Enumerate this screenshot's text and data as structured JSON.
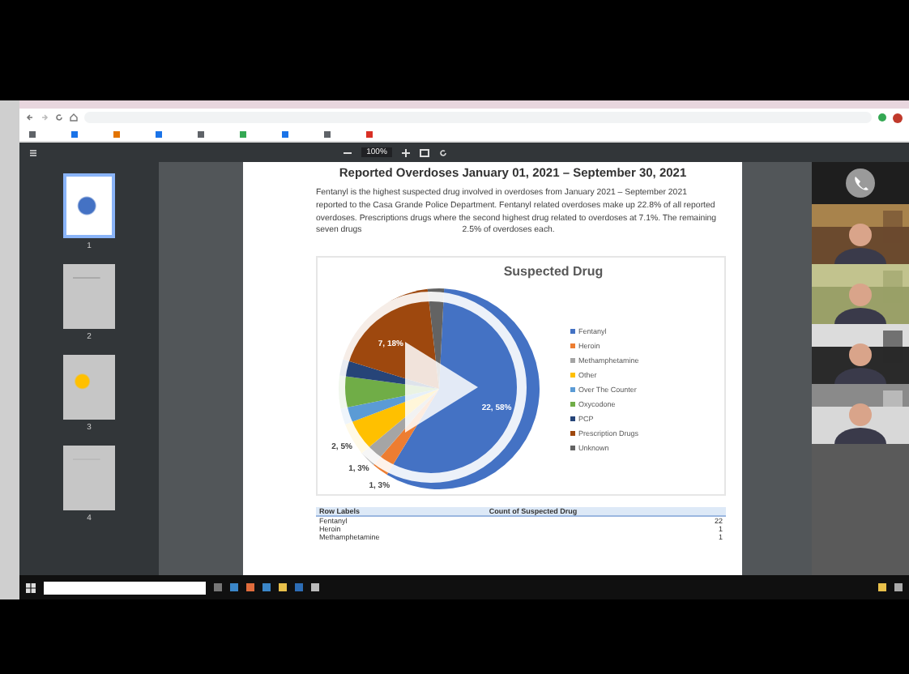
{
  "pdf_toolbar": {
    "zoom": "100%"
  },
  "thumbnails": [
    {
      "label": "1",
      "selected": true
    },
    {
      "label": "2",
      "selected": false
    },
    {
      "label": "3",
      "selected": false
    },
    {
      "label": "4",
      "selected": false
    }
  ],
  "document": {
    "heading": "Reported Overdoses January 01, 2021 – September 30, 2021",
    "paragraph": [
      "Fentanyl is the highest suspected drug involved in overdoses from January 2021 – September 2021 reported to the Casa Grande Police Department. Fentanyl related overdoses make up 22.8% of all reported overdoses. Prescriptions drugs where the second highest drug related to overdoses at 7.1%. The remaining seven drugs",
      "2.5% of overdoses each."
    ],
    "chart_data": {
      "type": "pie",
      "title": "Suspected Drug",
      "categories": [
        "Fentanyl",
        "Heroin",
        "Methamphetamine",
        "Other",
        "Over The Counter",
        "Oxycodone",
        "PCP",
        "Prescription Drugs",
        "Unknown"
      ],
      "values": [
        22,
        1,
        1,
        2,
        1,
        2,
        1,
        7,
        1
      ],
      "colors": [
        "#4472c4",
        "#ed7d31",
        "#a5a5a5",
        "#ffc000",
        "#5b9bd5",
        "#70ad47",
        "#264478",
        "#9e480e",
        "#636363"
      ],
      "value_labels": [
        "22, 58%",
        "1, 3%",
        "1, 3%",
        "2, 5%",
        null,
        null,
        null,
        "7, 18%",
        null
      ]
    },
    "table": {
      "columns": [
        "Row Labels",
        "Count of Suspected Drug"
      ],
      "rows": [
        [
          "Fentanyl",
          "22"
        ],
        [
          "Heroin",
          "1"
        ],
        [
          "Methamphetamine",
          "1"
        ]
      ]
    }
  },
  "call": {
    "participants": [
      {
        "kind": "audio"
      },
      {
        "kind": "video"
      },
      {
        "kind": "video"
      },
      {
        "kind": "video"
      },
      {
        "kind": "video"
      }
    ]
  }
}
